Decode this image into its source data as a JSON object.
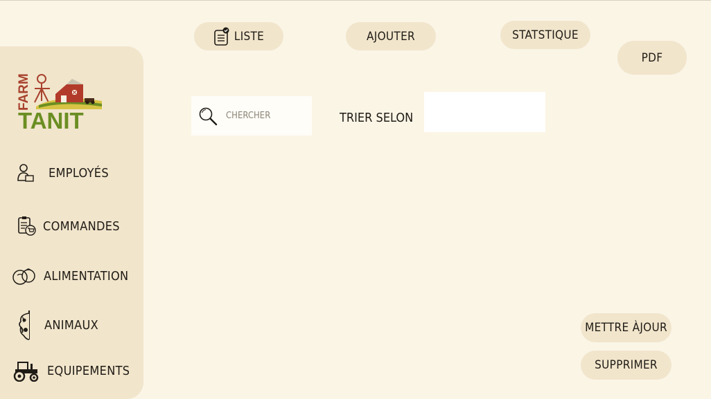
{
  "top_nav": {
    "list_label": "Liste",
    "add_label": "Ajouter",
    "stats_label": "Statstique",
    "pdf_label": "PDF"
  },
  "logo": {
    "line1": "FARM",
    "line2": "TANIT"
  },
  "sidebar": {
    "items": [
      {
        "label": "Employés",
        "icon": "employee-icon"
      },
      {
        "label": "Commandes",
        "icon": "orders-icon"
      },
      {
        "label": "Alimentation",
        "icon": "food-icon"
      },
      {
        "label": "Animaux",
        "icon": "animal-icon"
      },
      {
        "label": "Equipements",
        "icon": "tractor-icon"
      }
    ]
  },
  "toolbar": {
    "search_placeholder": "Chercher",
    "sort_label": "Trier selon",
    "sort_value": ""
  },
  "actions": {
    "update_label": "Mettre àjour",
    "delete_label": "Supprimer"
  },
  "colors": {
    "background": "#fbf5e6",
    "panel": "#f1e5cc",
    "brand_green": "#6b8e23",
    "brand_red": "#a8422e"
  }
}
